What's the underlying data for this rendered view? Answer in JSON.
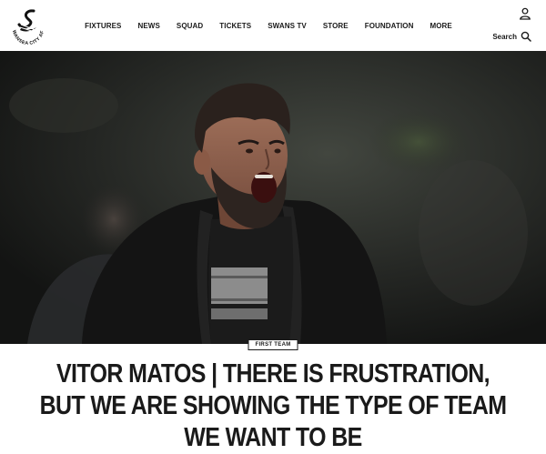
{
  "header": {
    "logo_text": "SWANSEA CITY AFC",
    "nav": [
      "FIXTURES",
      "NEWS",
      "SQUAD",
      "TICKETS",
      "SWANS TV",
      "STORE",
      "FOUNDATION",
      "MORE"
    ],
    "search_label": "Search",
    "account_icon": "user-icon",
    "search_icon": "magnifier-icon"
  },
  "hero": {
    "image": "photo of a bearded man in a black jacket shouting, dark stadium background"
  },
  "article": {
    "category": "FIRST TEAM",
    "headline": "VITOR MATOS | THERE IS FRUSTRATION, BUT WE ARE SHOWING THE TYPE OF TEAM WE WANT TO BE"
  },
  "colors": {
    "text": "#1a1a1a",
    "background": "#ffffff",
    "hero_dark": "#222421"
  }
}
